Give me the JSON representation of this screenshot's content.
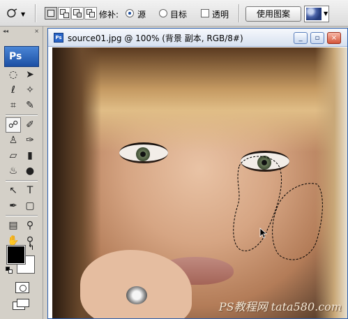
{
  "options_bar": {
    "patch_label": "修补:",
    "radio_source": "源",
    "radio_destination": "目标",
    "checkbox_transparent": "透明",
    "use_pattern_button": "使用图案",
    "colors": {
      "radio_dot": "#1b4d9e"
    }
  },
  "toolbox": {
    "logo_text": "Ps",
    "tools": [
      "marquee-icon",
      "move-icon",
      "lasso-icon",
      "magic-wand-icon",
      "crop-icon",
      "slice-icon",
      "patch-icon",
      "brush-icon",
      "stamp-icon",
      "history-brush-icon",
      "eraser-icon",
      "gradient-icon",
      "blur-icon",
      "dodge-icon",
      "path-select-icon",
      "type-icon",
      "pen-icon",
      "shape-icon",
      "notes-icon",
      "eyedropper-icon",
      "hand-icon",
      "zoom-icon"
    ],
    "foreground_color": "#000000",
    "background_color": "#ffffff"
  },
  "document": {
    "title": "source01.jpg @ 100% (背景 副本, RGB/8#)",
    "icon_text": "Ps",
    "minimize": "_",
    "restore": "▫",
    "close": "×",
    "watermark": "PS教程网 tata580.com"
  }
}
